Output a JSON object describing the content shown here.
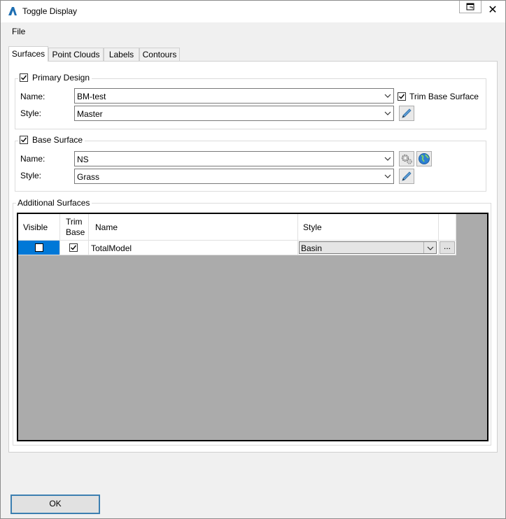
{
  "window": {
    "title": "Toggle Display"
  },
  "menu": {
    "file": "File"
  },
  "tabs": [
    {
      "label": "Surfaces",
      "active": true
    },
    {
      "label": "Point Clouds",
      "active": false
    },
    {
      "label": "Labels",
      "active": false
    },
    {
      "label": "Contours",
      "active": false
    }
  ],
  "primary_design": {
    "legend": "Primary Design",
    "checked": true,
    "name_label": "Name:",
    "name_value": "BM-test",
    "style_label": "Style:",
    "style_value": "Master",
    "trim_label": "Trim Base Surface",
    "trim_checked": true
  },
  "base_surface": {
    "legend": "Base Surface",
    "checked": true,
    "name_label": "Name:",
    "name_value": "NS",
    "style_label": "Style:",
    "style_value": "Grass"
  },
  "additional": {
    "legend": "Additional Surfaces",
    "columns": {
      "visible": "Visible",
      "trim_line1": "Trim",
      "trim_line2": "Base",
      "name": "Name",
      "style": "Style"
    },
    "rows": [
      {
        "visible": false,
        "trim": true,
        "name": "TotalModel",
        "style": "Basin",
        "more": "..."
      }
    ]
  },
  "buttons": {
    "ok": "OK"
  },
  "colors": {
    "selection": "#0078d7",
    "grid_bg": "#ababab",
    "ok_border": "#3c7fb1"
  }
}
